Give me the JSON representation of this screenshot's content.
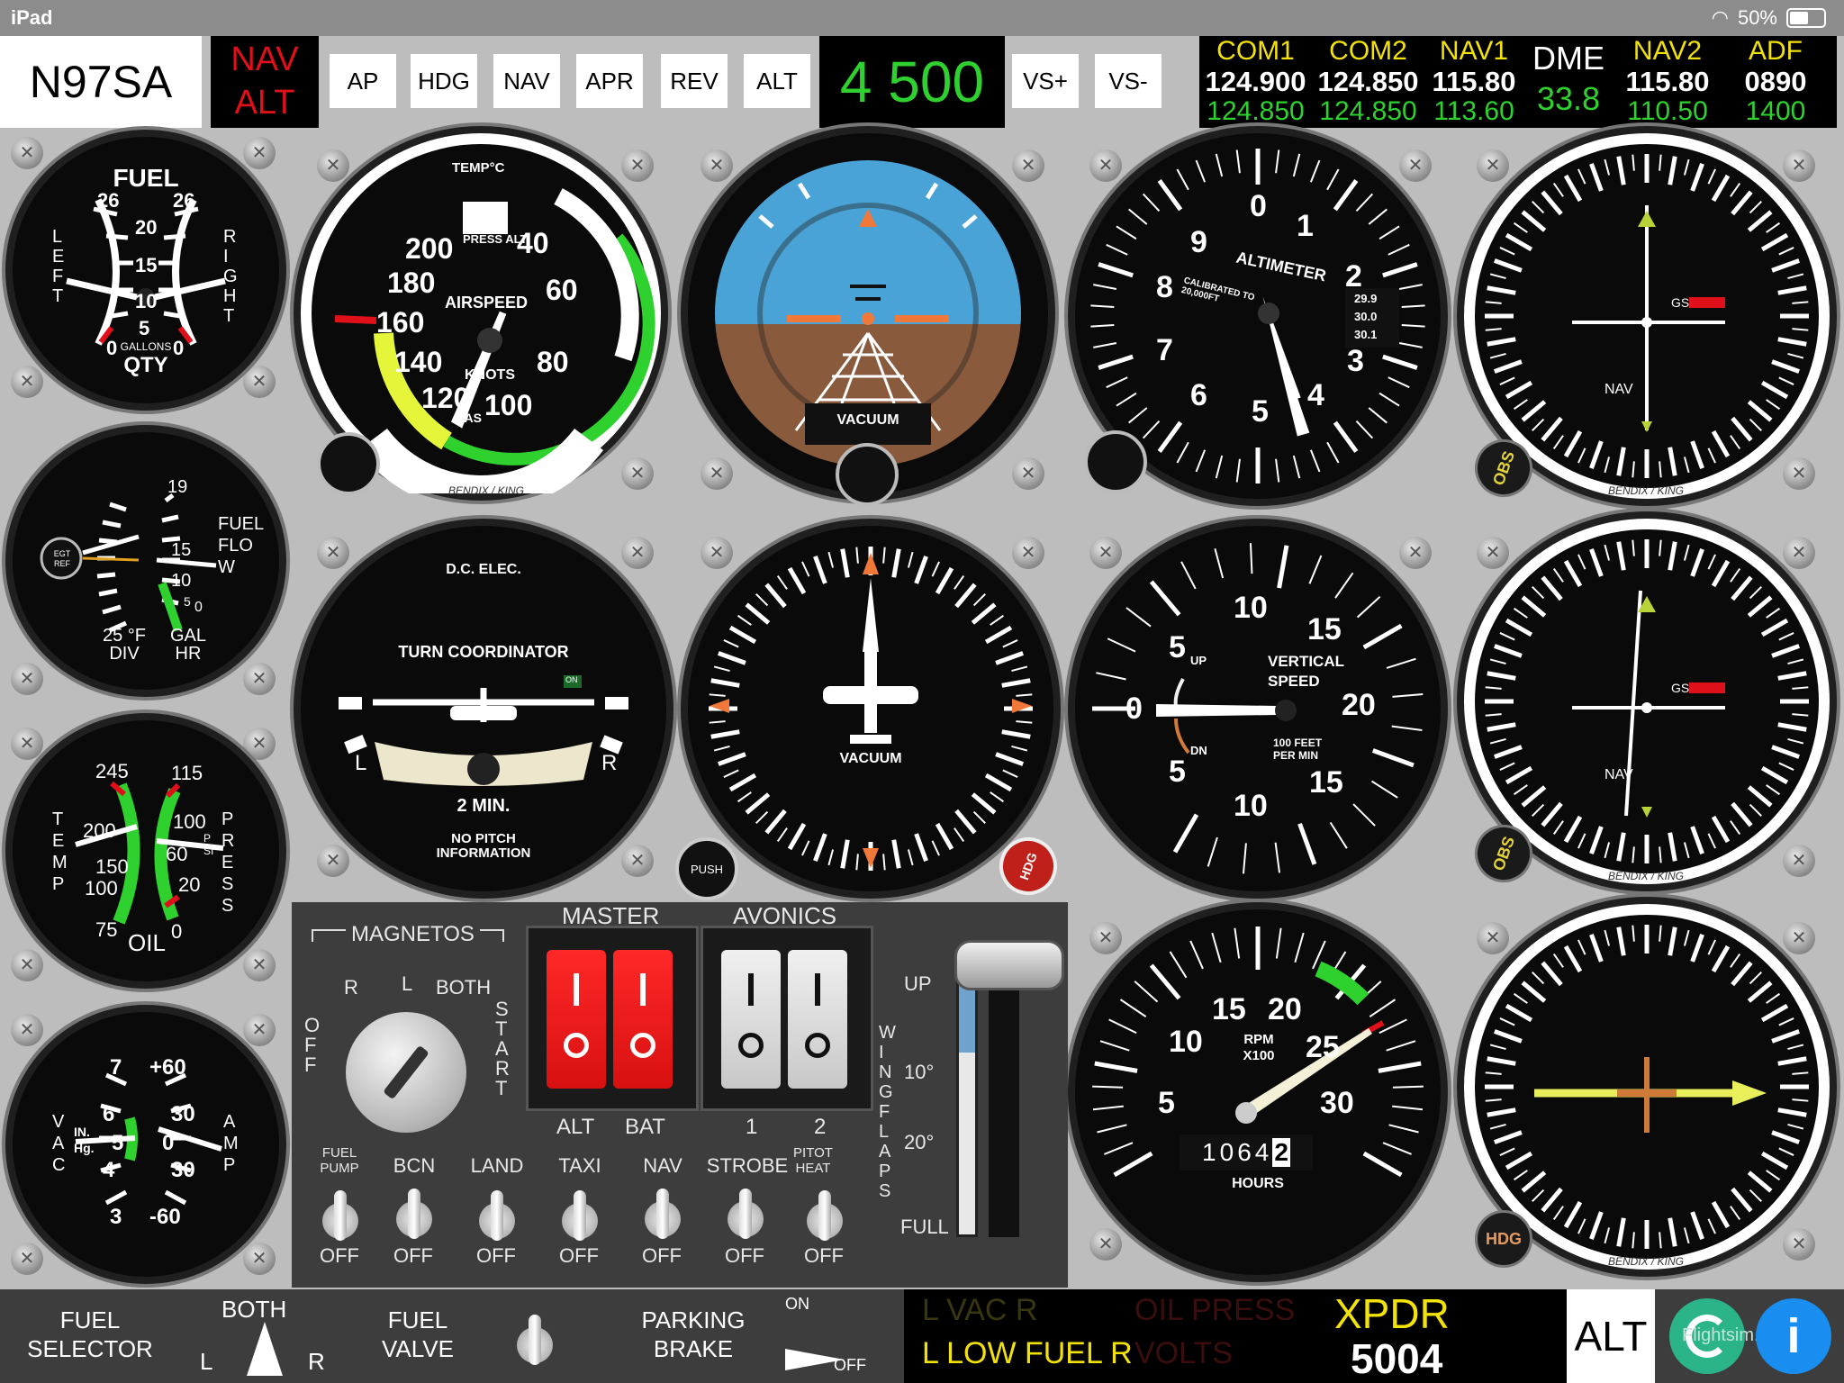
{
  "status_bar": {
    "device": "iPad",
    "battery": "50%"
  },
  "aircraft": {
    "tail_number": "N97SA"
  },
  "autopilot": {
    "status": [
      "NAV",
      "ALT"
    ],
    "buttons": [
      "AP",
      "HDG",
      "NAV",
      "APR",
      "REV",
      "ALT"
    ],
    "altitude": "4 500",
    "vs_up": "VS+",
    "vs_down": "VS-"
  },
  "radios": {
    "com1": {
      "label": "COM1",
      "active": "124.900",
      "standby": "124.850"
    },
    "com2": {
      "label": "COM2",
      "active": "124.850",
      "standby": "124.850"
    },
    "nav1": {
      "label": "NAV1",
      "active": "115.80",
      "standby": "113.60"
    },
    "dme": {
      "label": "DME",
      "value": "33.8"
    },
    "nav2": {
      "label": "NAV2",
      "active": "115.80",
      "standby": "110.50"
    },
    "adf": {
      "label": "ADF",
      "active": "0890",
      "standby": "1400"
    }
  },
  "gauges": {
    "fuel": {
      "title": "FUEL",
      "unit": "GALLONS",
      "sub": "QTY",
      "left": "LEFT",
      "right": "RIGHT",
      "ticks": [
        "26",
        "20",
        "15",
        "10",
        "5",
        "0"
      ]
    },
    "egt": {
      "ref": "EGT REF",
      "div": "25 °F DIV",
      "gal_hr": "GAL HR",
      "ff": "FUEL FLOW",
      "ticks": [
        "19",
        "15",
        "10",
        "5",
        "0"
      ]
    },
    "oil": {
      "temp": "TEMP",
      "press": "PRESS",
      "psi": "PSI",
      "label": "OIL",
      "ticks": [
        "245",
        "200",
        "150",
        "100",
        "75",
        "115",
        "100",
        "60",
        "20",
        "0"
      ]
    },
    "vac_amp": {
      "vac": "VAC",
      "amp": "AMP",
      "inhg": "IN. Hg.",
      "ticks": [
        "7",
        "6",
        "5",
        "4",
        "3",
        "+60",
        "30",
        "0",
        "30",
        "-60"
      ]
    },
    "airspeed": {
      "title": "AIRSPEED",
      "unit": "KNOTS",
      "temp": "TEMP°C",
      "press_alt": "PRESS ALT",
      "tas": "TAS",
      "brand": "BENDIX / KING",
      "ticks": [
        "40",
        "60",
        "80",
        "100",
        "120",
        "140",
        "160",
        "180",
        "200"
      ]
    },
    "attitude": {
      "label": "VACUUM"
    },
    "altimeter": {
      "title": "ALTIMETER",
      "calibrated": "CALIBRATED TO 20,000FT",
      "kollsman": [
        "29.9",
        "30.0",
        "30.1"
      ],
      "ticks": [
        "0",
        "1",
        "2",
        "3",
        "4",
        "5",
        "6",
        "7",
        "8",
        "9"
      ]
    },
    "nav1_cdi": {
      "gs": "GS",
      "nav": "NAV",
      "obs": "OBS",
      "brand": "BENDIX / KING"
    },
    "turn_coordinator": {
      "top": "D.C. ELEC.",
      "title": "TURN COORDINATOR",
      "on": "ON",
      "l": "L",
      "r": "R",
      "min": "2 MIN.",
      "note": "NO PITCH INFORMATION"
    },
    "heading": {
      "label": "VACUUM",
      "push": "PUSH",
      "hdg": "HDG"
    },
    "vsi": {
      "title": "VERTICAL SPEED",
      "unit": "100 FEET PER MIN",
      "up": "UP",
      "dn": "DN",
      "ticks": [
        "0",
        "5",
        "10",
        "15",
        "20",
        "15",
        "10",
        "5"
      ]
    },
    "nav2_cdi": {
      "gs": "GS",
      "nav": "NAV",
      "obs": "OBS",
      "brand": "BENDIX / KING"
    },
    "tach": {
      "unit": "RPM X100",
      "hours_label": "HOURS",
      "hours": [
        "1",
        "0",
        "6",
        "4",
        "2"
      ],
      "ticks": [
        "5",
        "10",
        "15",
        "20",
        "25",
        "30"
      ]
    },
    "adf": {
      "hdg": "HDG",
      "brand": "BENDIX / KING"
    }
  },
  "switches": {
    "magnetos": {
      "label": "MAGNETOS",
      "positions": [
        "OFF",
        "R",
        "L",
        "BOTH",
        "START"
      ]
    },
    "master": {
      "label": "MASTER",
      "alt": "ALT",
      "bat": "BAT"
    },
    "avionics": {
      "label": "AVONICS",
      "one": "1",
      "two": "2"
    },
    "toggles": [
      {
        "label": "FUEL PUMP",
        "state": "OFF"
      },
      {
        "label": "BCN",
        "state": "OFF"
      },
      {
        "label": "LAND",
        "state": "OFF"
      },
      {
        "label": "TAXI",
        "state": "OFF"
      },
      {
        "label": "NAV",
        "state": "OFF"
      },
      {
        "label": "STROBE",
        "state": "OFF"
      },
      {
        "label": "PITOT HEAT",
        "state": "OFF"
      }
    ],
    "flaps": {
      "label": "WING FLAPS",
      "up": "UP",
      "p10": "10°",
      "p20": "20°",
      "full": "FULL"
    }
  },
  "bottom": {
    "fuel_selector": "FUEL SELECTOR",
    "both": "BOTH",
    "l": "L",
    "r": "R",
    "fuel_valve": "FUEL VALVE",
    "parking_brake": "PARKING BRAKE",
    "on": "ON",
    "off": "OFF",
    "annunciators": {
      "vac": "L  VAC  R",
      "oil_press": "OIL PRESS",
      "low_fuel": "L  LOW FUEL  R",
      "volts": "VOLTS"
    },
    "xpdr": {
      "label": "XPDR",
      "code": "5004",
      "mode": "ALT"
    },
    "brand": "Flightsim.co"
  },
  "colors": {
    "accent_green": "#2fd12f",
    "accent_yellow": "#f3e20a",
    "warn_red": "#e0101a",
    "sky": "#4aa3d6",
    "ground": "#8a5a3c"
  }
}
